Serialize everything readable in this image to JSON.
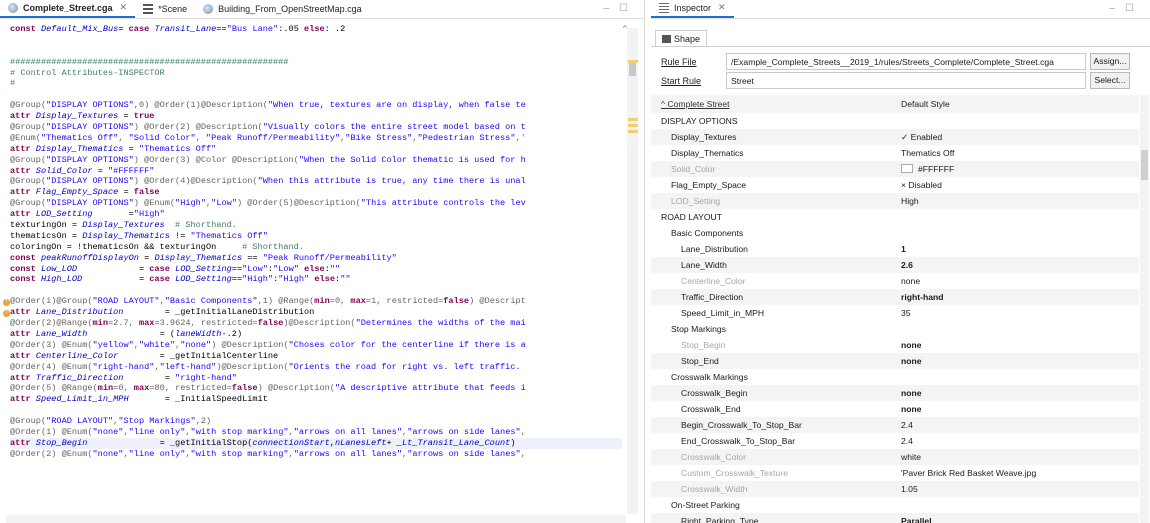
{
  "editor": {
    "tabs": [
      {
        "label": "Complete_Street.cga",
        "icon": "globe-icon",
        "active": true,
        "closable": true
      },
      {
        "label": "*Scene",
        "icon": "layers-icon",
        "active": false,
        "closable": false
      },
      {
        "label": "Building_From_OpenStreetMap.cga",
        "icon": "globe-icon",
        "active": false,
        "closable": false
      }
    ],
    "code_lines": [
      [
        [
          "kw",
          "const "
        ],
        [
          "it",
          "Default_Mix_Bus"
        ],
        [
          "",
          "= "
        ],
        [
          "kw",
          "case "
        ],
        [
          "it",
          "Transit_Lane"
        ],
        [
          "",
          "=="
        ],
        [
          "st",
          "\"Bus Lane\""
        ],
        [
          "",
          ":.05 "
        ],
        [
          "kw",
          "else"
        ],
        [
          "",
          ": .2"
        ]
      ],
      [],
      [],
      [
        [
          "cm",
          "######################################################"
        ]
      ],
      [
        [
          "cm",
          "# Control Attributes-INSPECTOR"
        ]
      ],
      [
        [
          "cm",
          "#"
        ]
      ],
      [],
      [
        [
          "an",
          "@Group("
        ],
        [
          "st",
          "\"DISPLAY OPTIONS\""
        ],
        [
          "an",
          ",0) @Order(1)@Description("
        ],
        [
          "st",
          "\"When true, textures are on display, when false te"
        ]
      ],
      [
        [
          "kw",
          "attr "
        ],
        [
          "it",
          "Display_Textures"
        ],
        [
          "",
          "",
          " = "
        ],
        [
          "kw",
          "true"
        ]
      ],
      [
        [
          "an",
          "@Group("
        ],
        [
          "st",
          "\"DISPLAY OPTIONS\""
        ],
        [
          "an",
          ") @Order(2) @Description("
        ],
        [
          "st",
          "\"Visually colors the entire street model based on t"
        ]
      ],
      [
        [
          "an",
          "@Enum("
        ],
        [
          "st",
          "\"Thematics Off\""
        ],
        [
          "an",
          ", "
        ],
        [
          "st",
          "\"Solid Color\""
        ],
        [
          "an",
          ", "
        ],
        [
          "st",
          "\"Peak Runoff/Permeability\""
        ],
        [
          "an",
          ","
        ],
        [
          "st",
          "\"Bike Stress\""
        ],
        [
          "an",
          ","
        ],
        [
          "st",
          "\"Pedestrian Stress\""
        ],
        [
          "an",
          ",'"
        ]
      ],
      [
        [
          "kw",
          "attr "
        ],
        [
          "it",
          "Display_Thematics"
        ],
        [
          "",
          " = "
        ],
        [
          "st",
          "\"Thematics Off\""
        ]
      ],
      [
        [
          "an",
          "@Group("
        ],
        [
          "st",
          "\"DISPLAY OPTIONS\""
        ],
        [
          "an",
          ") @Order(3) @Color @Description("
        ],
        [
          "st",
          "\"When the Solid Color thematic is used for h"
        ]
      ],
      [
        [
          "kw",
          "attr "
        ],
        [
          "it",
          "Solid_Color"
        ],
        [
          "",
          " = "
        ],
        [
          "st",
          "\"#FFFFFF\""
        ]
      ],
      [
        [
          "an",
          "@Group("
        ],
        [
          "st",
          "\"DISPLAY OPTIONS\""
        ],
        [
          "an",
          ") @Order(4)@Description("
        ],
        [
          "st",
          "\"When this attribute is true, any time there is unal"
        ]
      ],
      [
        [
          "kw",
          "attr "
        ],
        [
          "it",
          "Flag_Empty_Space"
        ],
        [
          "",
          " = "
        ],
        [
          "kw",
          "false"
        ]
      ],
      [
        [
          "an",
          "@Group("
        ],
        [
          "st",
          "\"DISPLAY OPTIONS\""
        ],
        [
          "an",
          ") @Enum("
        ],
        [
          "st",
          "\"High\""
        ],
        [
          "an",
          ","
        ],
        [
          "st",
          "\"Low\""
        ],
        [
          "an",
          ") @Order(5)@Description("
        ],
        [
          "st",
          "\"This attribute controls the lev"
        ]
      ],
      [
        [
          "kw",
          "attr "
        ],
        [
          "it",
          "LOD_Setting"
        ],
        [
          "",
          "       ="
        ],
        [
          "st",
          "\"High\""
        ]
      ],
      [
        [
          "",
          "texturingOn = "
        ],
        [
          "it",
          "Display_Textures"
        ],
        [
          "",
          "  "
        ],
        [
          "cm",
          "# Shorthand."
        ]
      ],
      [
        [
          "",
          "thematicsOn = "
        ],
        [
          "it",
          "Display_Thematics"
        ],
        [
          "",
          " != "
        ],
        [
          "st",
          "\"Thematics Off\""
        ]
      ],
      [
        [
          "",
          "coloringOn = !thematicsOn && texturingOn     "
        ],
        [
          "cm",
          "# Shorthand."
        ]
      ],
      [
        [
          "kw",
          "const "
        ],
        [
          "it",
          "peakRunoffDisplayOn"
        ],
        [
          "",
          " = "
        ],
        [
          "it",
          "Display_Thematics"
        ],
        [
          "",
          " == "
        ],
        [
          "st",
          "\"Peak Runoff/Permeability\""
        ]
      ],
      [
        [
          "kw",
          "const "
        ],
        [
          "it",
          "Low_LOD"
        ],
        [
          "",
          "            = "
        ],
        [
          "kw",
          "case "
        ],
        [
          "it",
          "LOD_Setting"
        ],
        [
          "",
          "=="
        ],
        [
          "st",
          "\"Low\""
        ],
        [
          "",
          ":"
        ],
        [
          "st",
          "\"Low\""
        ],
        [
          "",
          " "
        ],
        [
          "kw",
          "else"
        ],
        [
          "",
          ":"
        ],
        [
          "st",
          "\"\""
        ]
      ],
      [
        [
          "kw",
          "const "
        ],
        [
          "it",
          "High_LOD"
        ],
        [
          "",
          "           = "
        ],
        [
          "kw",
          "case "
        ],
        [
          "it",
          "LOD_Setting"
        ],
        [
          "",
          "=="
        ],
        [
          "st",
          "\"High\""
        ],
        [
          "",
          ":"
        ],
        [
          "st",
          "\"High\""
        ],
        [
          "",
          " "
        ],
        [
          "kw",
          "else"
        ],
        [
          "",
          ":"
        ],
        [
          "st",
          "\"\""
        ]
      ],
      [],
      [
        [
          "an",
          "@Order(1)@Group("
        ],
        [
          "st",
          "\"ROAD LAYOUT\""
        ],
        [
          "an",
          ","
        ],
        [
          "st",
          "\"Basic Components\""
        ],
        [
          "an",
          ",1) @Range("
        ],
        [
          "kw",
          "min"
        ],
        [
          "an",
          "=0, "
        ],
        [
          "kw",
          "max"
        ],
        [
          "an",
          "=1, restricted="
        ],
        [
          "kw",
          "false"
        ],
        [
          "an",
          ") @Descript"
        ]
      ],
      [
        [
          "kw",
          "attr "
        ],
        [
          "it",
          "Lane_Distribution"
        ],
        [
          "",
          "        = _getInitialLaneDistribution"
        ]
      ],
      [
        [
          "an",
          "@Order(2)@Range("
        ],
        [
          "kw",
          "min"
        ],
        [
          "an",
          "=2.7, "
        ],
        [
          "kw",
          "max"
        ],
        [
          "an",
          "=3.9624, restricted="
        ],
        [
          "kw",
          "false"
        ],
        [
          "an",
          ")@Description("
        ],
        [
          "st",
          "\"Determines the widths of the mai"
        ]
      ],
      [
        [
          "kw",
          "attr "
        ],
        [
          "it",
          "Lane_Width"
        ],
        [
          "",
          "              = ("
        ],
        [
          "it",
          "laneWidth"
        ],
        [
          "",
          "-.2)"
        ]
      ],
      [
        [
          "an",
          "@Order(3) @Enum("
        ],
        [
          "st",
          "\"yellow\""
        ],
        [
          "an",
          ","
        ],
        [
          "st",
          "\"white\""
        ],
        [
          "an",
          ","
        ],
        [
          "st",
          "\"none\""
        ],
        [
          "an",
          ") @Description("
        ],
        [
          "st",
          "\"Choses color for the centerline if there is a"
        ]
      ],
      [
        [
          "kw",
          "attr "
        ],
        [
          "it",
          "Centerline_Color"
        ],
        [
          "",
          "        = _getInitialCenterline"
        ]
      ],
      [
        [
          "an",
          "@Order(4) @Enum("
        ],
        [
          "st",
          "\"right-hand\""
        ],
        [
          "an",
          ","
        ],
        [
          "st",
          "\"left-hand\""
        ],
        [
          "an",
          ")@Description("
        ],
        [
          "st",
          "\"Orients the road for right vs. left traffic."
        ]
      ],
      [
        [
          "kw",
          "attr "
        ],
        [
          "it",
          "Traffic_Direction"
        ],
        [
          "",
          "        = "
        ],
        [
          "st",
          "\"right-hand\""
        ]
      ],
      [
        [
          "an",
          "@Order(5) @Range("
        ],
        [
          "kw",
          "min"
        ],
        [
          "an",
          "=0, "
        ],
        [
          "kw",
          "max"
        ],
        [
          "an",
          "=80, restricted="
        ],
        [
          "kw",
          "false"
        ],
        [
          "an",
          ") @Description("
        ],
        [
          "st",
          "\"A descriptive attribute that feeds i"
        ]
      ],
      [
        [
          "kw",
          "attr "
        ],
        [
          "it",
          "Speed_Limit_in_MPH"
        ],
        [
          "",
          "       = _InitialSpeedLimit"
        ]
      ],
      [],
      [
        [
          "an",
          "@Group("
        ],
        [
          "st",
          "\"ROAD LAYOUT\""
        ],
        [
          "an",
          ","
        ],
        [
          "st",
          "\"Stop Markings\""
        ],
        [
          "an",
          ",2)"
        ]
      ],
      [
        [
          "an",
          "@Order(1) @Enum("
        ],
        [
          "st",
          "\"none\""
        ],
        [
          "an",
          ","
        ],
        [
          "st",
          "\"line only\""
        ],
        [
          "an",
          ","
        ],
        [
          "st",
          "\"with stop marking\""
        ],
        [
          "an",
          ","
        ],
        [
          "st",
          "\"arrows on all lanes\""
        ],
        [
          "an",
          ","
        ],
        [
          "st",
          "\"arrows on side lanes\""
        ],
        [
          "an",
          ","
        ]
      ],
      [
        [
          "kw",
          "attr "
        ],
        [
          "it",
          "Stop_Begin"
        ],
        [
          "",
          "              = _getInitialStop("
        ],
        [
          "it",
          "connectionStart"
        ],
        [
          "",
          ","
        ],
        [
          "it",
          "nLanesLeft"
        ],
        [
          "",
          "+ "
        ],
        [
          "it",
          "_Lt_Transit_Lane_Count"
        ],
        [
          "",
          ")"
        ]
      ],
      [
        [
          "an",
          "@Order(2) @Enum("
        ],
        [
          "st",
          "\"none\""
        ],
        [
          "an",
          ","
        ],
        [
          "st",
          "\"line only\""
        ],
        [
          "an",
          ","
        ],
        [
          "st",
          "\"with stop marking\""
        ],
        [
          "an",
          ","
        ],
        [
          "st",
          "\"arrows on all lanes\""
        ],
        [
          "an",
          ","
        ],
        [
          "st",
          "\"arrows on side lanes\""
        ],
        [
          "an",
          ","
        ]
      ]
    ]
  },
  "inspector": {
    "tab_label": "Inspector",
    "shape_tab": "Shape",
    "rule_file_label": "Rule File",
    "rule_file_value": "/Example_Complete_Streets__2019_1/rules/Streets_Complete/Complete_Street.cga",
    "assign_button": "Assign...",
    "start_rule_label": "Start Rule",
    "start_rule_value": "Street",
    "select_button": "Select...",
    "rows": [
      {
        "key": "Complete Street",
        "value": "Default Style",
        "indent": 0,
        "kind": "header"
      },
      {
        "key": "DISPLAY OPTIONS",
        "value": "",
        "indent": 0,
        "kind": "group"
      },
      {
        "key": "Display_Textures",
        "value": "✓ Enabled",
        "indent": 1
      },
      {
        "key": "Display_Thematics",
        "value": "Thematics Off",
        "indent": 1
      },
      {
        "key": "Solid_Color",
        "value": "#FFFFFF",
        "indent": 1,
        "disabled": true,
        "swatch": "#ffffff"
      },
      {
        "key": "Flag_Empty_Space",
        "value": "× Disabled",
        "indent": 1
      },
      {
        "key": "LOD_Setting",
        "value": "High",
        "indent": 1,
        "disabled": true
      },
      {
        "key": "ROAD LAYOUT",
        "value": "",
        "indent": 0,
        "kind": "group"
      },
      {
        "key": "Basic Components",
        "value": "",
        "indent": 1,
        "kind": "group"
      },
      {
        "key": "Lane_Distribution",
        "value": "1",
        "indent": 2,
        "bold": true
      },
      {
        "key": "Lane_Width",
        "value": "2.6",
        "indent": 2,
        "bold": true
      },
      {
        "key": "Centerline_Color",
        "value": "none",
        "indent": 2,
        "disabled": true
      },
      {
        "key": "Traffic_Direction",
        "value": "right-hand",
        "indent": 2,
        "bold": true
      },
      {
        "key": "Speed_Limit_in_MPH",
        "value": "35",
        "indent": 2
      },
      {
        "key": "Stop Markings",
        "value": "",
        "indent": 1,
        "kind": "group"
      },
      {
        "key": "Stop_Begin",
        "value": "none",
        "indent": 2,
        "disabled": true,
        "bold": true
      },
      {
        "key": "Stop_End",
        "value": "none",
        "indent": 2,
        "bold": true
      },
      {
        "key": "Crosswalk Markings",
        "value": "",
        "indent": 1,
        "kind": "group"
      },
      {
        "key": "Crosswalk_Begin",
        "value": "none",
        "indent": 2,
        "bold": true
      },
      {
        "key": "Crosswalk_End",
        "value": "none",
        "indent": 2,
        "bold": true
      },
      {
        "key": "Begin_Crosswalk_To_Stop_Bar",
        "value": "2.4",
        "indent": 2
      },
      {
        "key": "End_Crosswalk_To_Stop_Bar",
        "value": "2.4",
        "indent": 2
      },
      {
        "key": "Crosswalk_Color",
        "value": "white",
        "indent": 2,
        "disabled": true
      },
      {
        "key": "Custom_Crosswalk_Texture",
        "value": "'Paver Brick Red Basket Weave.jpg",
        "indent": 2,
        "disabled": true
      },
      {
        "key": "Crosswalk_Width",
        "value": "1.05",
        "indent": 2,
        "disabled": true
      },
      {
        "key": "On-Street Parking",
        "value": "",
        "indent": 1,
        "kind": "group"
      },
      {
        "key": "Right_Parking_Type",
        "value": "Parallel",
        "indent": 2,
        "bold": true
      }
    ]
  }
}
